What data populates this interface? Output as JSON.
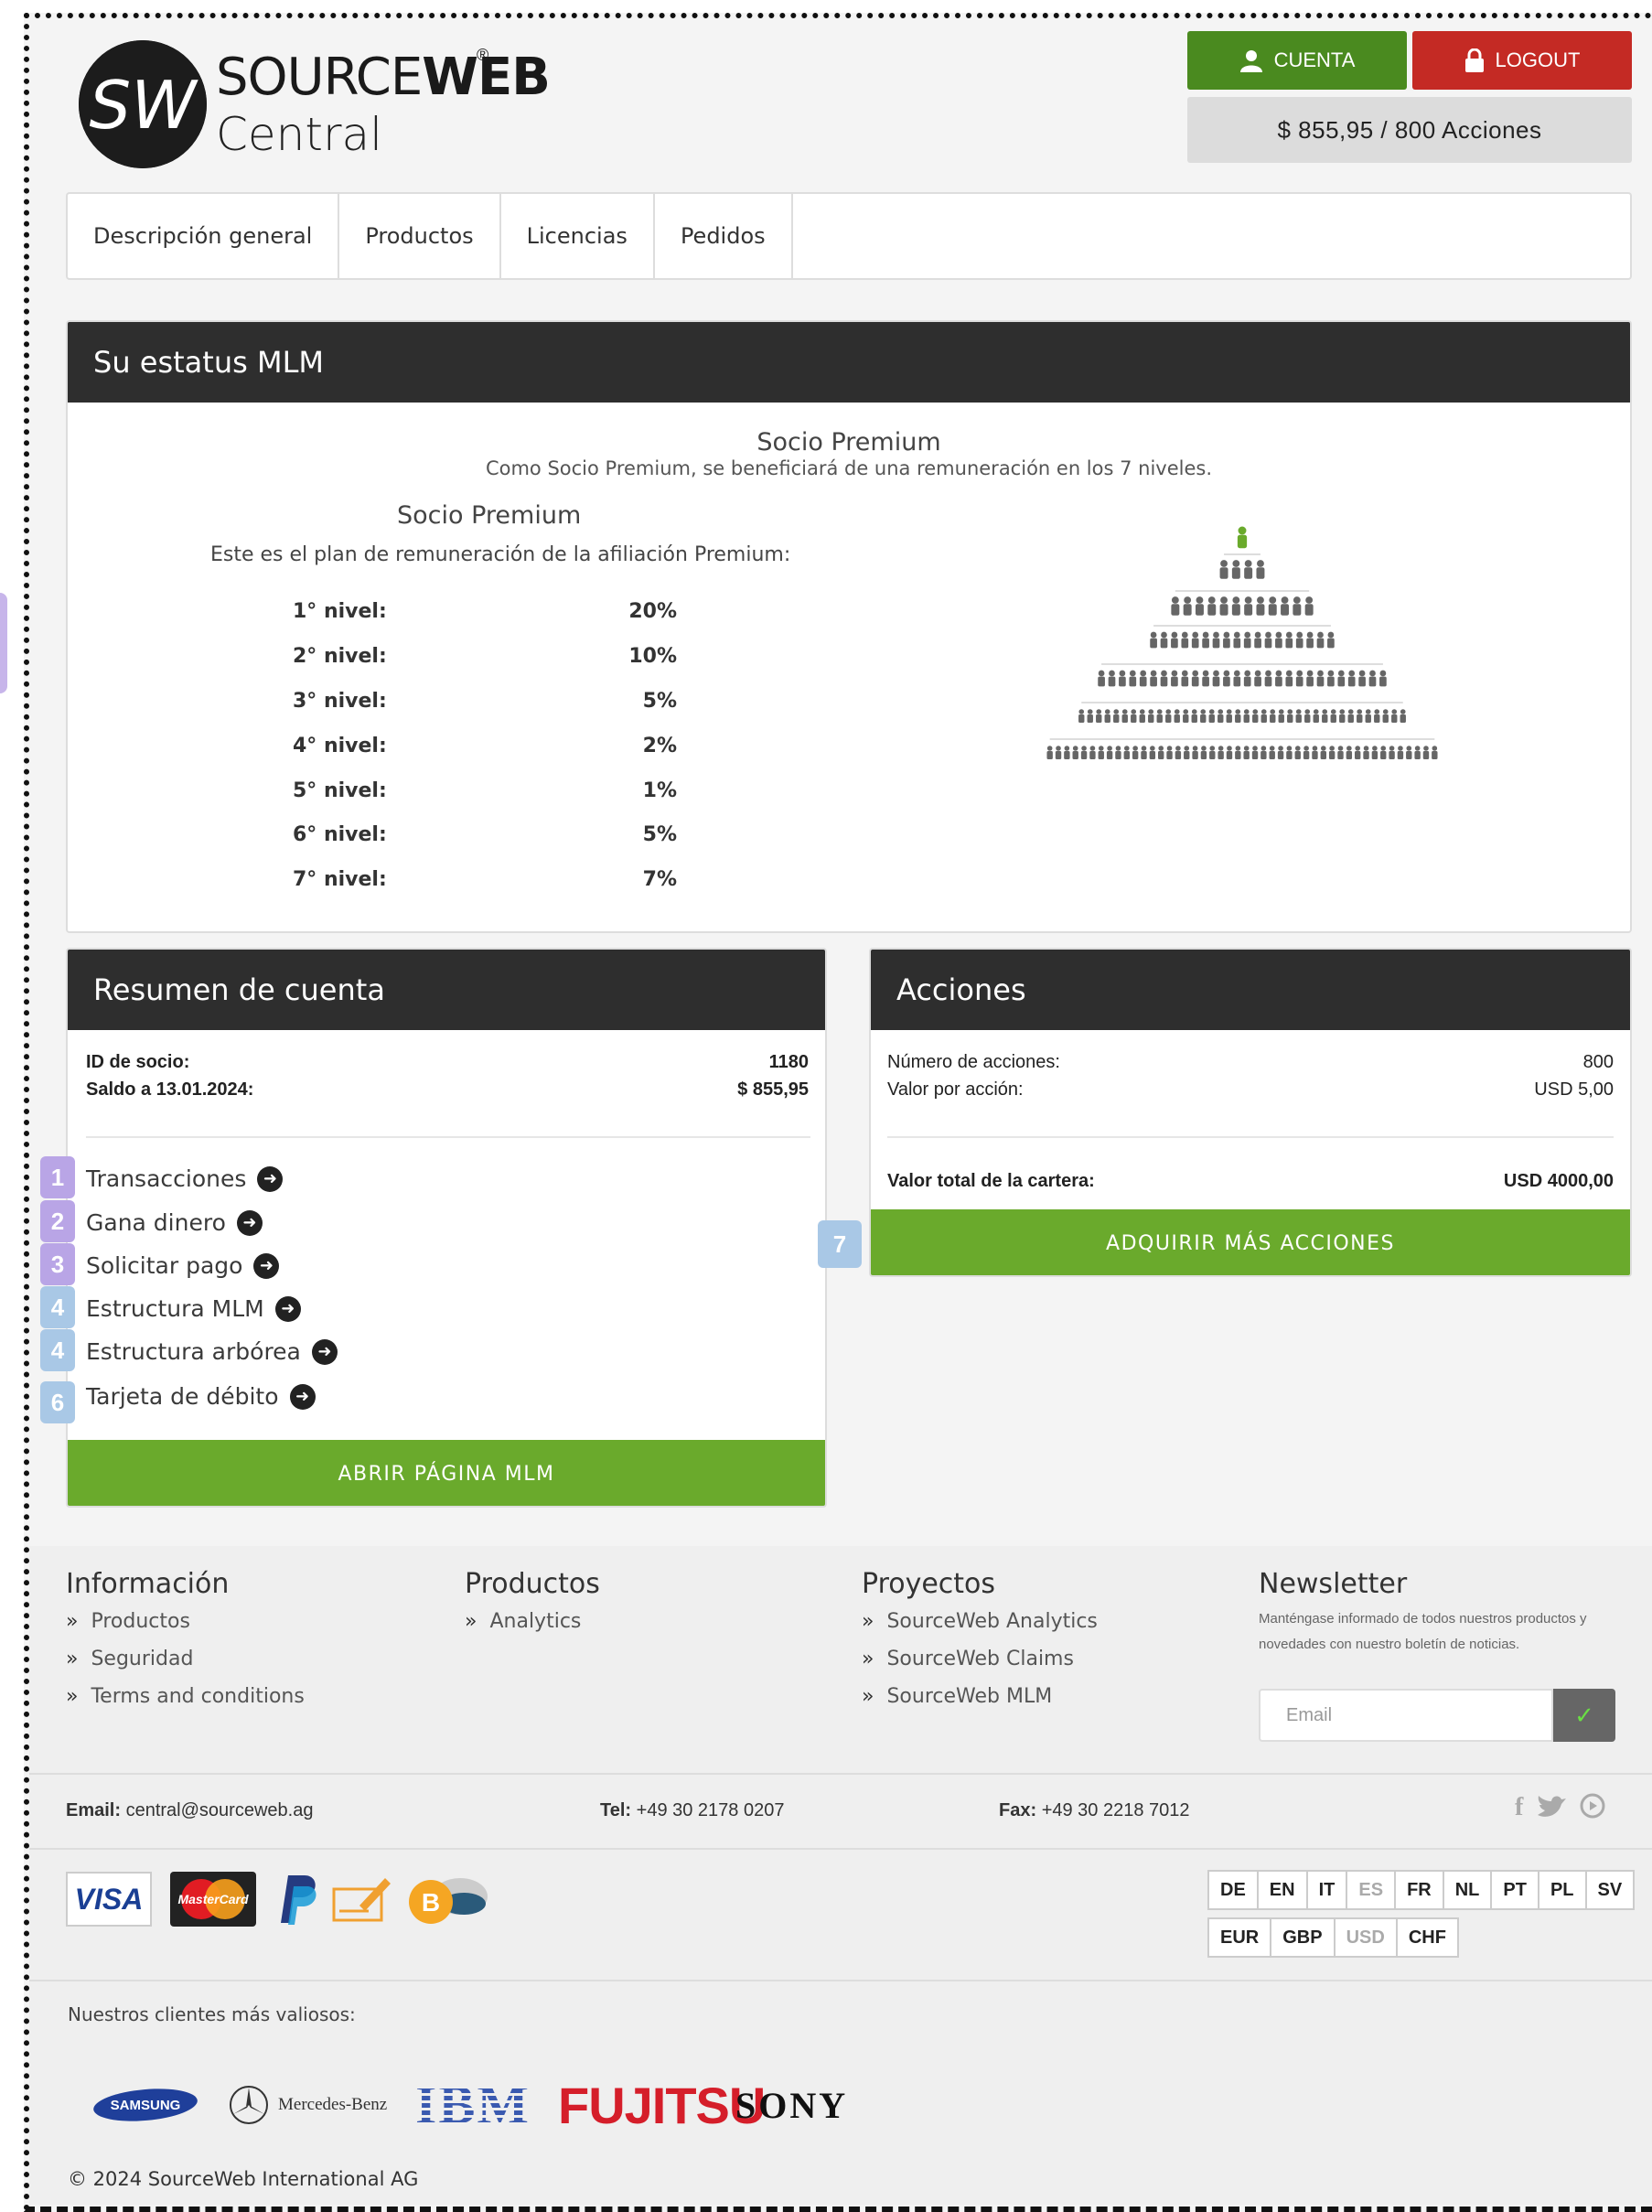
{
  "header": {
    "logo_word_light": "SOURCE",
    "logo_word_bold": "WEB",
    "logo_registered": "®",
    "logo_sub": "Central",
    "logo_initials": "SW",
    "account_button": "CUENTA",
    "logout_button": "LOGOUT",
    "balance": "$ 855,95 / 800 Acciones"
  },
  "nav": {
    "items": [
      "Descripción general",
      "Productos",
      "Licencias",
      "Pedidos"
    ]
  },
  "mlm": {
    "header": "Su estatus MLM",
    "status_title": "Socio Premium",
    "status_desc": "Como Socio Premium, se beneficiará de una remuneración en los 7 niveles.",
    "plan_title": "Socio Premium",
    "plan_desc": "Este es el plan de remuneración de la afiliación Premium:",
    "levels": [
      {
        "label": "1° nivel:",
        "pct": "20%"
      },
      {
        "label": "2° nivel:",
        "pct": "10%"
      },
      {
        "label": "3° nivel:",
        "pct": "5%"
      },
      {
        "label": "4° nivel:",
        "pct": "2%"
      },
      {
        "label": "5° nivel:",
        "pct": "1%"
      },
      {
        "label": "6° nivel:",
        "pct": "5%"
      },
      {
        "label": "7° nivel:",
        "pct": "7%"
      }
    ]
  },
  "account": {
    "header": "Resumen de cuenta",
    "member_id_label": "ID de socio:",
    "member_id": "1180",
    "balance_label": "Saldo a 13.01.2024:",
    "balance": "$ 855,95",
    "links": [
      {
        "label": "Transacciones",
        "marker": "1"
      },
      {
        "label": "Gana dinero",
        "marker": "2"
      },
      {
        "label": "Solicitar pago",
        "marker": "3"
      },
      {
        "label": "Estructura MLM",
        "marker": "4"
      },
      {
        "label": "Estructura arbórea",
        "marker": "4"
      },
      {
        "label": "Tarjeta de débito",
        "marker": "6"
      }
    ],
    "open_button": "ABRIR PÁGINA MLM"
  },
  "shares": {
    "header": "Acciones",
    "count_label": "Número de acciones:",
    "count": "800",
    "value_label": "Valor por acción:",
    "value": "USD 5,00",
    "total_label": "Valor total de la cartera:",
    "total": "USD 4000,00",
    "buy_button": "ADQUIRIR MÁS ACCIONES",
    "marker": "7"
  },
  "footer": {
    "info_title": "Información",
    "info_links": [
      "Productos",
      "Seguridad",
      "Terms and conditions"
    ],
    "products_title": "Productos",
    "products_links": [
      "Analytics"
    ],
    "projects_title": "Proyectos",
    "projects_links": [
      "SourceWeb Analytics",
      "SourceWeb Claims",
      "SourceWeb MLM"
    ],
    "newsletter_title": "Newsletter",
    "newsletter_text": "Manténgase informado de todos nuestros productos y novedades con nuestro boletín de noticias.",
    "newsletter_placeholder": "Email",
    "email_label": "Email:",
    "email": "central@sourceweb.ag",
    "tel_label": "Tel:",
    "tel": "+49 30 2178 0207",
    "fax_label": "Fax:",
    "fax": "+49 30 2218 7012",
    "payments": [
      "VISA",
      "MasterCard",
      "PayPal",
      "cheque",
      "Bitcoin"
    ],
    "languages": [
      "DE",
      "EN",
      "IT",
      "ES",
      "FR",
      "NL",
      "PT",
      "PL",
      "SV"
    ],
    "active_language": "ES",
    "currencies": [
      "EUR",
      "GBP",
      "USD",
      "CHF"
    ],
    "active_currency": "USD",
    "clients_label": "Nuestros clientes más valiosos:",
    "clients": [
      "SAMSUNG",
      "Mercedes-Benz",
      "IBM",
      "FUJITSU",
      "SONY"
    ],
    "copyright": "© 2024 SourceWeb International AG"
  },
  "colors": {
    "green_dark": "#4a8a1f",
    "green_button": "#6aaa2c",
    "red": "#c42a24",
    "panel_header": "#2e2e2e",
    "marker_purple": "#b9a5e6",
    "marker_blue": "#a9c8e6"
  }
}
